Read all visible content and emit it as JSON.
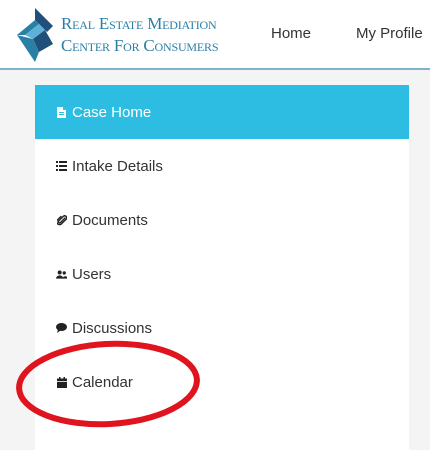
{
  "header": {
    "brand_line1": "Real Estate Mediation",
    "brand_line2": "Center For Consumers",
    "nav": [
      {
        "label": "Home"
      },
      {
        "label": "My Profile"
      }
    ]
  },
  "sidebar": {
    "items": [
      {
        "label": "Case Home",
        "icon": "document-icon",
        "active": true
      },
      {
        "label": "Intake Details",
        "icon": "list-icon",
        "active": false
      },
      {
        "label": "Documents",
        "icon": "paperclip-icon",
        "active": false
      },
      {
        "label": "Users",
        "icon": "users-icon",
        "active": false
      },
      {
        "label": "Discussions",
        "icon": "chat-bubble-icon",
        "active": false
      },
      {
        "label": "Calendar",
        "icon": "calendar-icon",
        "active": false
      }
    ]
  },
  "colors": {
    "active_bg": "#2ebde2",
    "brand_blue": "#2a7fa5",
    "header_rule": "#7fb3cc",
    "annotation_red": "#e0141e"
  }
}
